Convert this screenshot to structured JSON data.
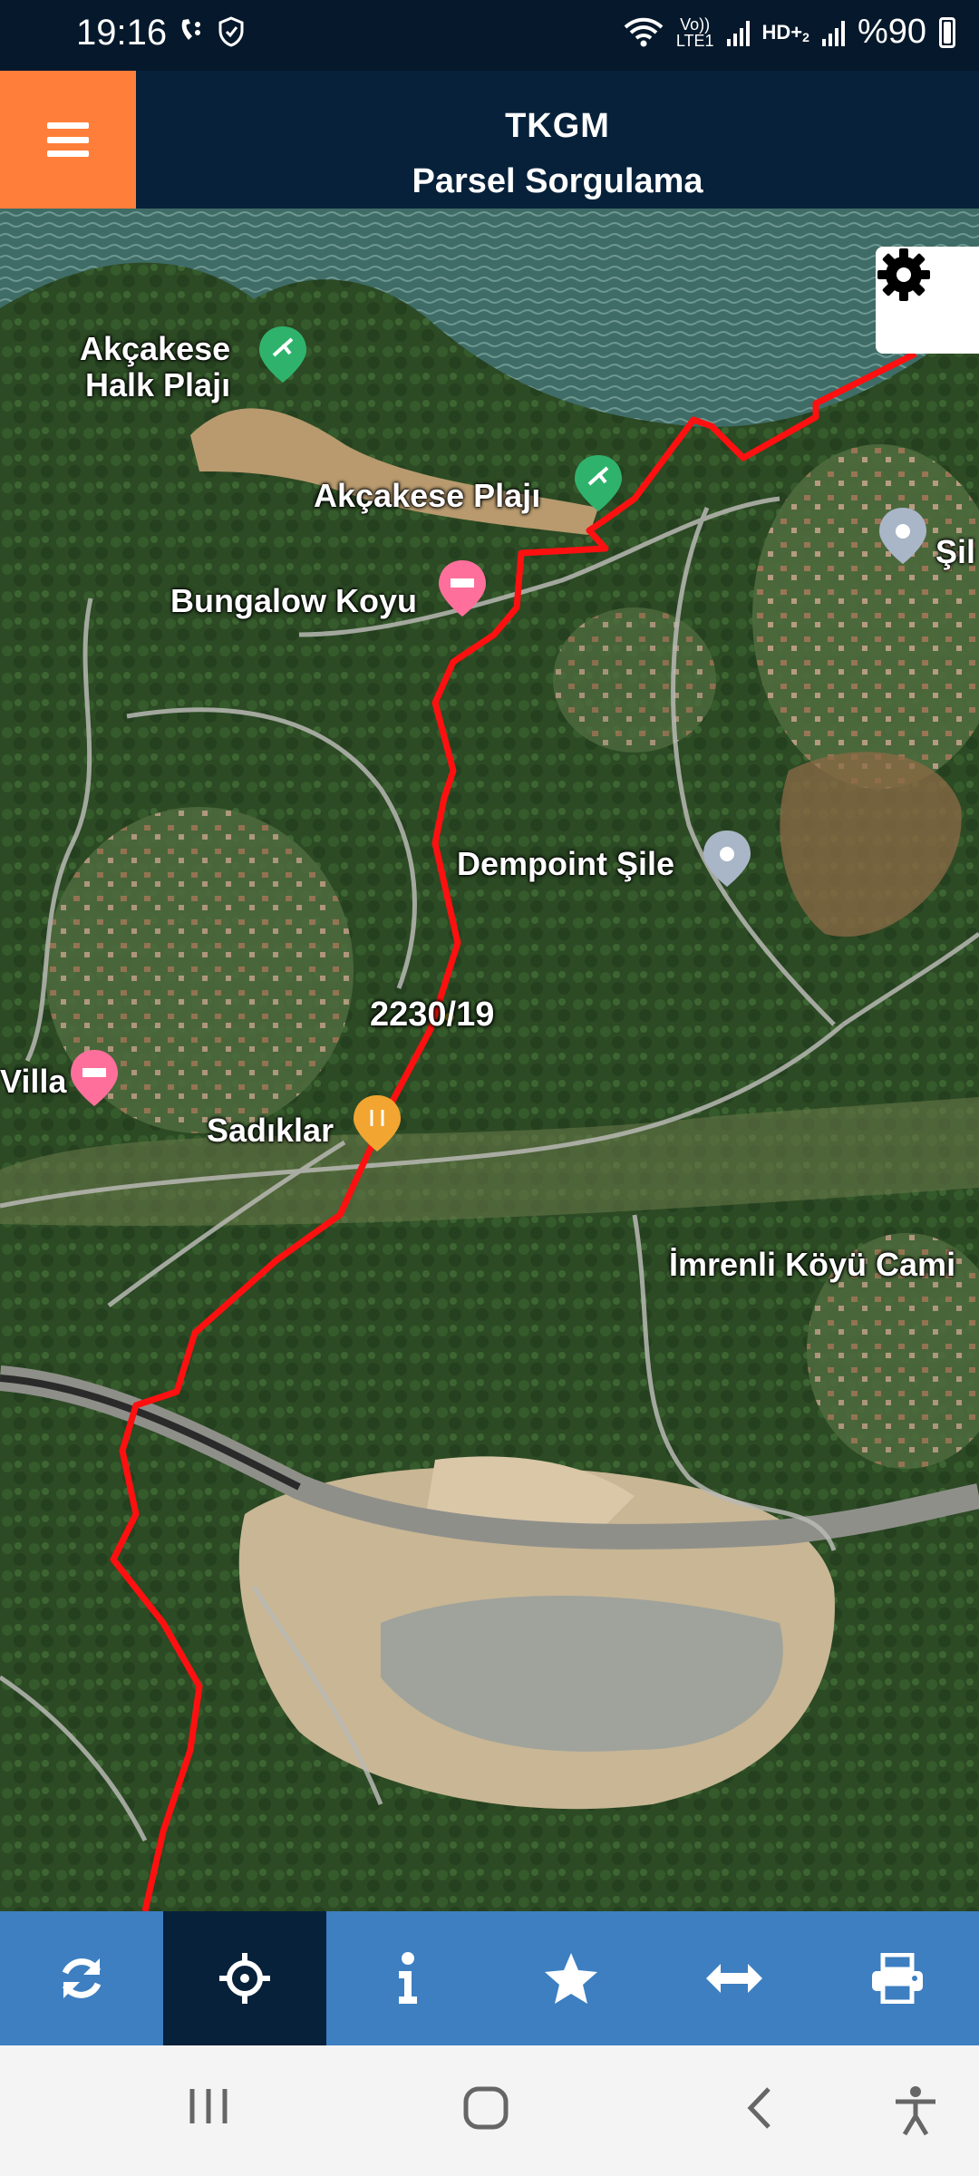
{
  "status_bar": {
    "time": "19:16",
    "net_volte_top": "Vo))",
    "net_volte_bottom": "LTE1",
    "net_hd": "HD+",
    "net_hd_sub": "2",
    "battery_text": "%90",
    "icons": [
      "call-forward-icon",
      "shield-icon",
      "wifi-icon",
      "signal-icon",
      "battery-icon"
    ]
  },
  "header": {
    "title": "TKGM",
    "subtitle": "Parsel Sorgulama",
    "accent_color": "#ff7f3a",
    "bg_color": "#07213a"
  },
  "map": {
    "labels": {
      "akcakese_halk_1": "Akçakese",
      "akcakese_halk_2": "Halk Plajı",
      "akcakese_plaji": "Akçakese Plajı",
      "bungalow": "Bungalow Koyu",
      "sile": "Şil",
      "dempoint": "Dempoint Şile",
      "parcel": "2230/19",
      "villa": "Villa",
      "sadiklar": "Sadıklar",
      "imrenli": "İmrenli Köyü Cami"
    },
    "boundary_color": "#ff1010"
  },
  "toolbar": {
    "items": [
      "refresh-icon",
      "locate-icon",
      "info-icon",
      "star-icon",
      "measure-icon",
      "print-icon"
    ],
    "active": "locate-icon",
    "color": "#3d7fc1"
  },
  "nav_bar": {
    "items": [
      "recents-icon",
      "home-icon",
      "back-icon",
      "accessibility-icon"
    ]
  }
}
